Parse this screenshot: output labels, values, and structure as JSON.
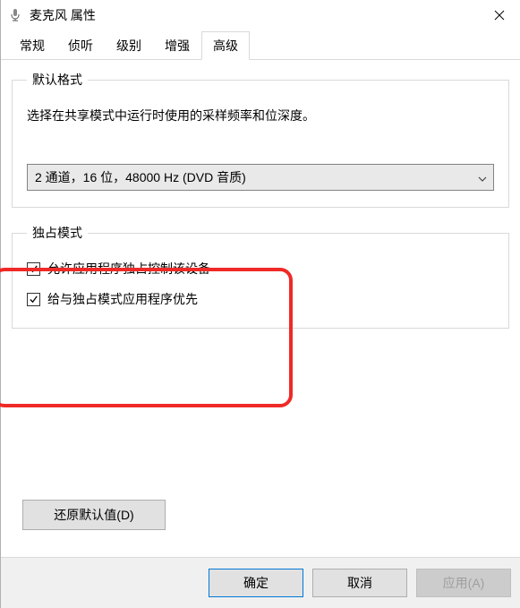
{
  "window": {
    "title": "麦克风 属性"
  },
  "tabs": {
    "items": [
      {
        "label": "常规"
      },
      {
        "label": "侦听"
      },
      {
        "label": "级别"
      },
      {
        "label": "增强"
      },
      {
        "label": "高级"
      }
    ],
    "active_index": 4
  },
  "default_format": {
    "legend": "默认格式",
    "description": "选择在共享模式中运行时使用的采样频率和位深度。",
    "selected": "2 通道，16 位，48000 Hz (DVD 音质)"
  },
  "exclusive_mode": {
    "legend": "独占模式",
    "allow_control": {
      "label": "允许应用程序独占控制该设备",
      "checked": true
    },
    "give_priority": {
      "label": "给与独占模式应用程序优先",
      "checked": true
    }
  },
  "restore_defaults": {
    "label": "还原默认值(D)"
  },
  "footer": {
    "ok": "确定",
    "cancel": "取消",
    "apply": "应用(A)"
  },
  "highlight": {
    "color": "#ef2a27"
  }
}
